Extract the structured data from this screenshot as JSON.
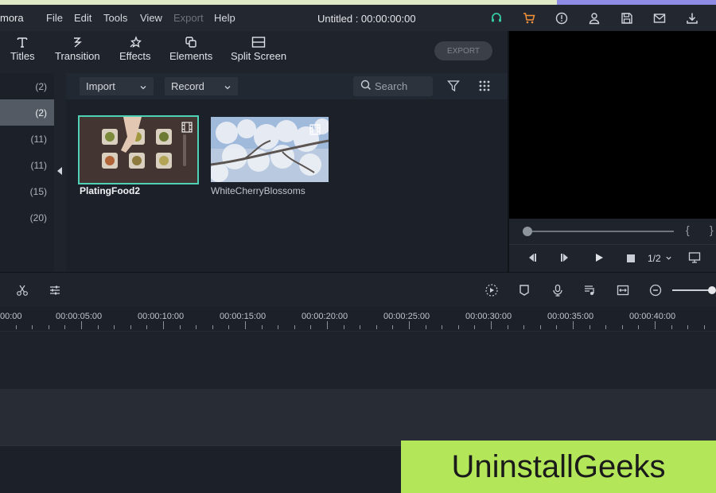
{
  "menubar": {
    "app_name": "mora",
    "items": [
      "File",
      "Edit",
      "Tools",
      "View",
      "Export",
      "Help"
    ],
    "title": "Untitled : 00:00:00:00",
    "icons": [
      "headset-icon",
      "cart-icon",
      "info-icon",
      "user-icon",
      "save-icon",
      "mail-icon",
      "download-icon"
    ]
  },
  "toolbar": {
    "tools": [
      {
        "label": "Titles",
        "icon": "titles-icon"
      },
      {
        "label": "Transition",
        "icon": "transition-icon"
      },
      {
        "label": "Effects",
        "icon": "effects-icon"
      },
      {
        "label": "Elements",
        "icon": "elements-icon"
      },
      {
        "label": "Split Screen",
        "icon": "split-screen-icon"
      }
    ],
    "export_label": "EXPORT"
  },
  "left_panel": {
    "counts": [
      "(2)",
      "(2)",
      "(11)",
      "(11)",
      "(15)",
      "(20)"
    ],
    "selected_index": 1
  },
  "media": {
    "import_label": "Import",
    "record_label": "Record",
    "search_placeholder": "Search",
    "clips": [
      {
        "name": "PlatingFood2",
        "selected": true
      },
      {
        "name": "WhiteCherryBlossoms",
        "selected": false
      }
    ]
  },
  "preview": {
    "ratio": "1/2",
    "bracket_left": "{",
    "bracket_right": "}"
  },
  "timeline": {
    "timecodes": [
      "00:00",
      "00:00:05:00",
      "00:00:10:00",
      "00:00:15:00",
      "00:00:20:00",
      "00:00:25:00",
      "00:00:30:00",
      "00:00:35:00",
      "00:00:40:00"
    ]
  },
  "watermark": {
    "text": "UninstallGeeks"
  },
  "colors": {
    "accent": "#4fd1b5",
    "cart": "#f3913a",
    "headset": "#35c9a1",
    "watermark_bg": "#b4e65a"
  }
}
